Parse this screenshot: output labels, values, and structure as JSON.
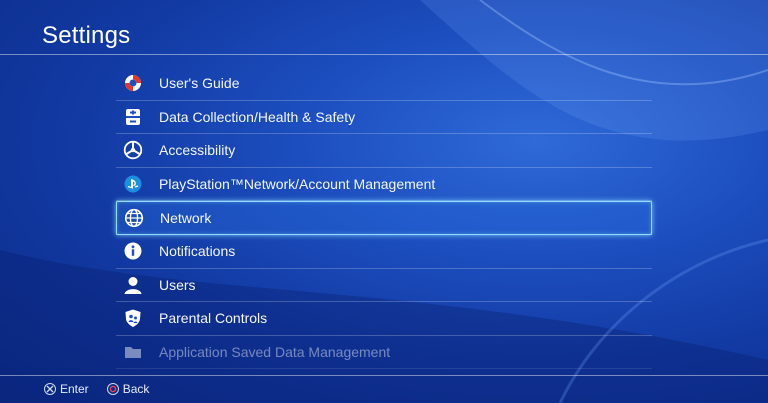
{
  "header": {
    "title": "Settings"
  },
  "menu": {
    "items": [
      {
        "label": "User's Guide",
        "icon": "lifebuoy-icon"
      },
      {
        "label": "Data Collection/Health & Safety",
        "icon": "data-collection-icon"
      },
      {
        "label": "Accessibility",
        "icon": "accessibility-icon"
      },
      {
        "label": "PlayStation™Network/Account Management",
        "icon": "playstation-network-icon"
      },
      {
        "label": "Network",
        "icon": "globe-icon",
        "selected": true
      },
      {
        "label": "Notifications",
        "icon": "info-icon"
      },
      {
        "label": "Users",
        "icon": "user-icon"
      },
      {
        "label": "Parental Controls",
        "icon": "parental-controls-icon"
      },
      {
        "label": "Application Saved Data Management",
        "icon": "folder-icon"
      }
    ]
  },
  "footer": {
    "enter_label": "Enter",
    "back_label": "Back",
    "enter_button_icon": "cross-button-icon",
    "back_button_icon": "circle-button-icon"
  },
  "colors": {
    "background": "#1d4fc0",
    "selection_border": "#8fdcff",
    "lifebuoy_red": "#e0382b",
    "circle_button": "#e8455a"
  }
}
